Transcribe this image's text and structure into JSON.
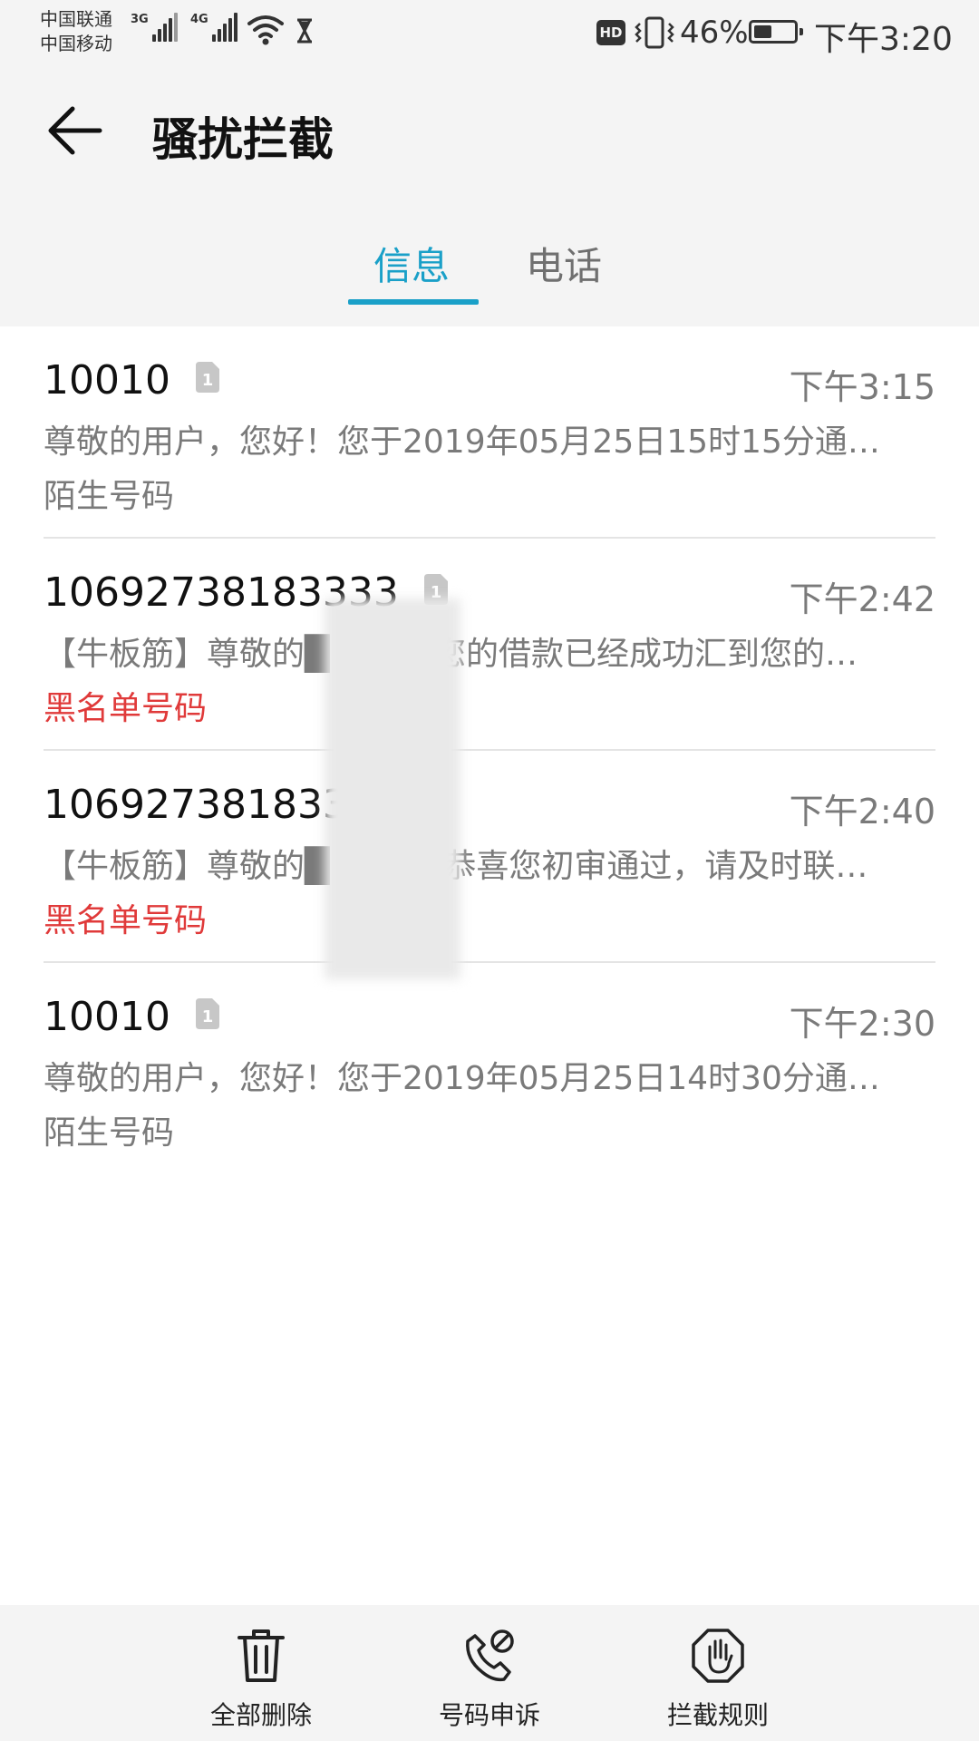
{
  "status_bar": {
    "carrier_1": "中国联通",
    "carrier_2": "中国移动",
    "network_1": "3G",
    "network_2": "4G",
    "hd_label": "HD",
    "battery_percent": "46%",
    "battery_level": 0.46,
    "time": "下午3:20",
    "icons": [
      "signal-icon",
      "wifi-icon",
      "hourglass-icon",
      "vibrate-icon",
      "battery-icon"
    ]
  },
  "header": {
    "back_icon": "arrow-left-icon",
    "title": "骚扰拦截"
  },
  "tabs": [
    {
      "label": "信息",
      "active": true
    },
    {
      "label": "电话",
      "active": false
    }
  ],
  "colors": {
    "accent": "#1aa0c8",
    "blacklist": "#e03a3a",
    "secondary_text": "#7a7a7a"
  },
  "messages": [
    {
      "sender": "10010",
      "sim_badge": "1",
      "time": "下午3:15",
      "preview": "尊敬的用户，您好！您于2019年05月25日15时15分通…",
      "tag": "陌生号码",
      "tag_type": "stranger"
    },
    {
      "sender": "10692738183333",
      "sim_badge": "1",
      "time": "下午2:42",
      "preview": "【牛板筋】尊敬的█ █ █，您的借款已经成功汇到您的…",
      "tag": "黑名单号码",
      "tag_type": "blacklist"
    },
    {
      "sender": "1069273818333",
      "sim_badge": "",
      "time": "下午2:40",
      "preview": "【牛板筋】尊敬的█ █ █ ，恭喜您初审通过，请及时联…",
      "tag": "黑名单号码",
      "tag_type": "blacklist"
    },
    {
      "sender": "10010",
      "sim_badge": "1",
      "time": "下午2:30",
      "preview": "尊敬的用户，您好！您于2019年05月25日14时30分通…",
      "tag": "陌生号码",
      "tag_type": "stranger"
    }
  ],
  "toolbar": [
    {
      "label": "全部删除",
      "icon": "trash-icon"
    },
    {
      "label": "号码申诉",
      "icon": "phone-block-icon"
    },
    {
      "label": "拦截规则",
      "icon": "stop-hand-icon"
    }
  ]
}
